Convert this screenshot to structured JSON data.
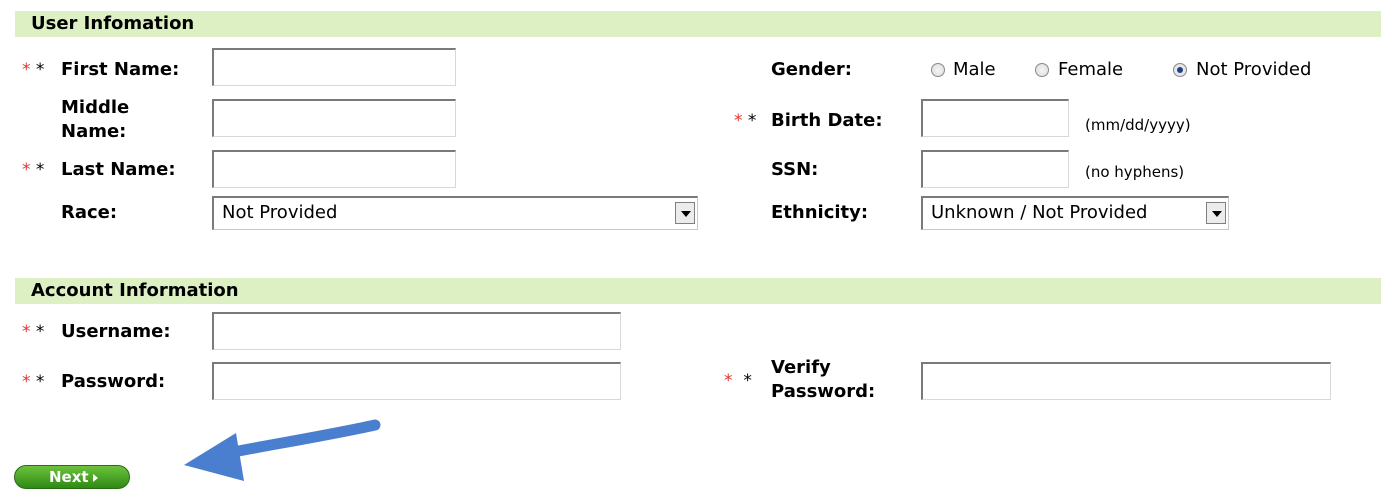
{
  "user_info": {
    "title": "User Infomation",
    "first_name_label": "First Name:",
    "middle_name_label_1": "Middle",
    "middle_name_label_2": "Name:",
    "last_name_label": "Last Name:",
    "race_label": "Race:",
    "race_value": "Not Provided",
    "gender_label": "Gender:",
    "gender_options": [
      "Male",
      "Female",
      "Not Provided"
    ],
    "gender_selected": "Not Provided",
    "birth_date_label": "Birth Date:",
    "birth_date_hint": "(mm/dd/yyyy)",
    "ssn_label": "SSN:",
    "ssn_hint": "(no hyphens)",
    "ethnicity_label": "Ethnicity:",
    "ethnicity_value": "Unknown / Not Provided"
  },
  "account_info": {
    "title": "Account Information",
    "username_label": "Username:",
    "password_label": "Password:",
    "verify_label_1": "Verify",
    "verify_label_2": "Password:"
  },
  "required_marker": "*",
  "next_button_label": "Next",
  "colors": {
    "header_bg": "#dcf0c4",
    "required_red": "#e0342f",
    "button_green": "#3f9f1f",
    "arrow_blue": "#4a7fd0"
  }
}
